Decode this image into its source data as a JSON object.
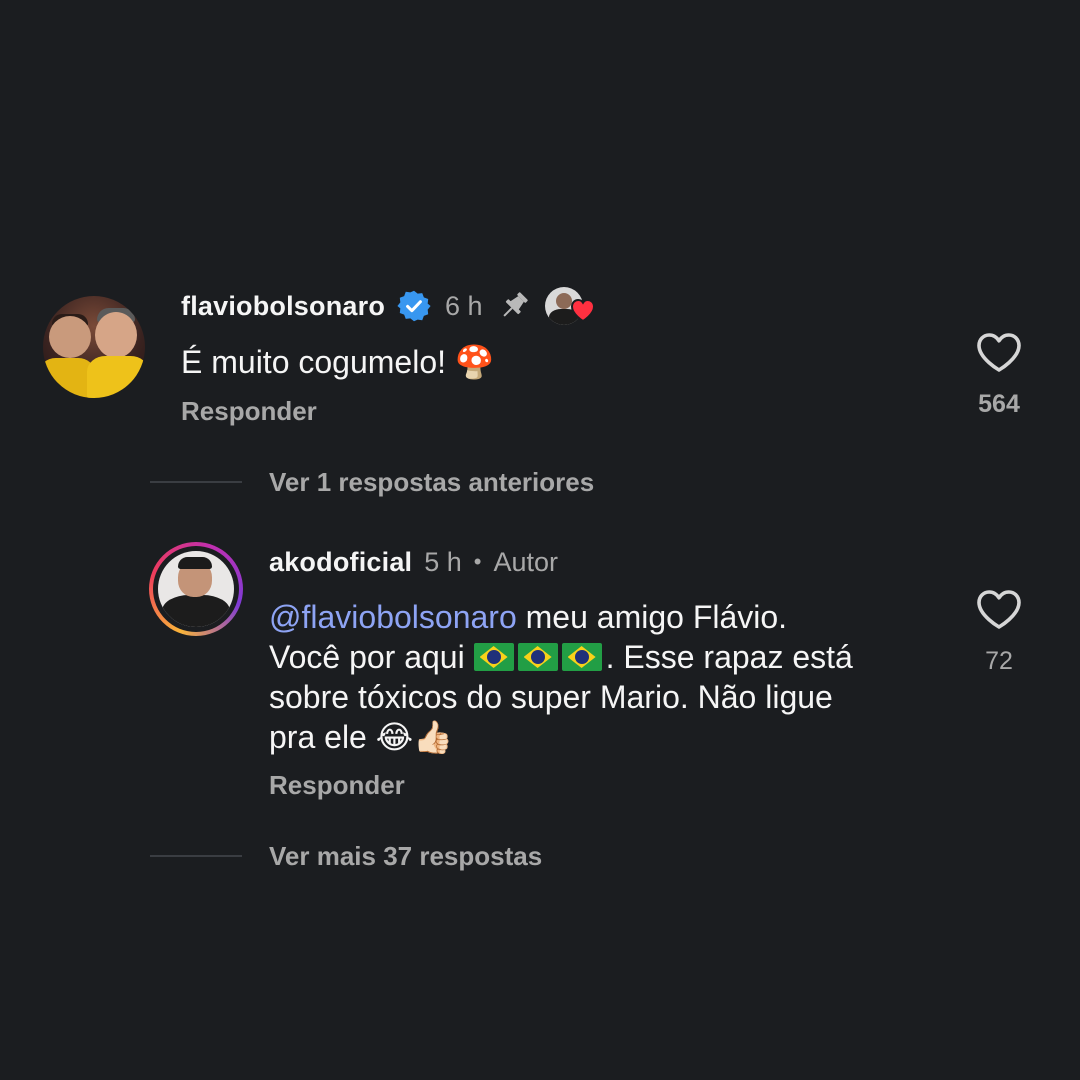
{
  "comments": [
    {
      "username": "flaviobolsonaro",
      "time": "6 h",
      "text": "É muito cogumelo! 🍄",
      "reply_label": "Responder",
      "likes": "564",
      "verified": true,
      "pinned": true,
      "liked_by_author": true
    },
    {
      "username": "akodoficial",
      "time": "5 h",
      "author_tag": "Autor",
      "mention": "@flaviobolsonaro",
      "line1_rest": " meu amigo Flávio.",
      "line2_start": "Você por aqui ",
      "line2_end": ". Esse rapaz está",
      "line3": "sobre tóxicos do super Mario. Não ligue",
      "line4": "pra ele 😂👍🏻",
      "reply_label": "Responder",
      "likes": "72"
    }
  ],
  "threads": {
    "view_previous": "Ver 1 respostas anteriores",
    "view_more": "Ver mais 37 respostas"
  },
  "colors": {
    "background": "#1b1d20",
    "verified": "#3897f0",
    "mention": "#8ea4f4",
    "heart_badge": "#ff3040"
  }
}
